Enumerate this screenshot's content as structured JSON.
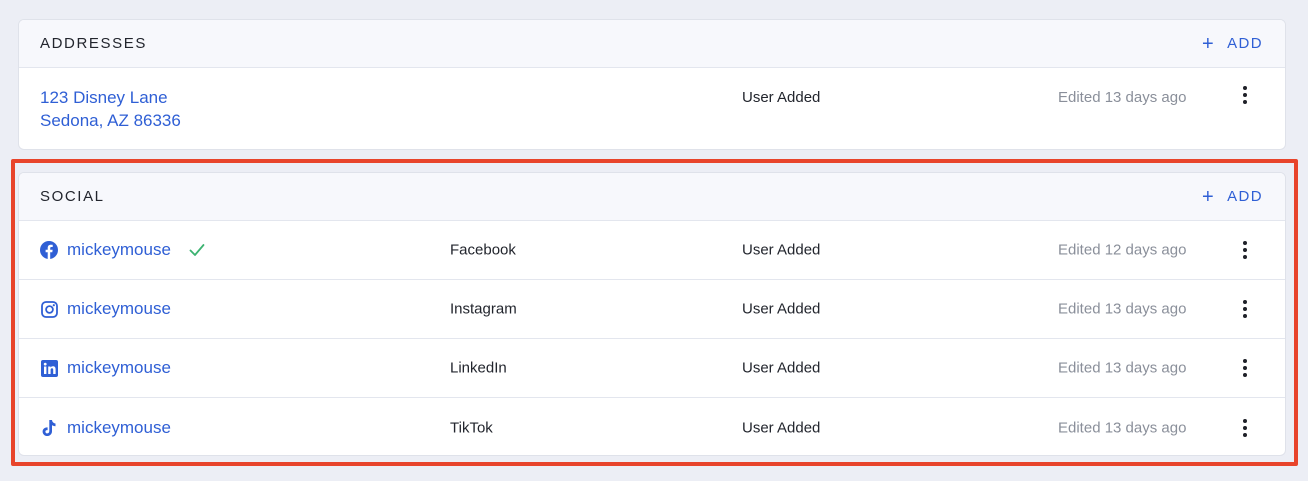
{
  "addresses": {
    "title": "ADDRESSES",
    "add_label": "ADD",
    "items": [
      {
        "line1": "123 Disney Lane",
        "line2": "Sedona, AZ 86336",
        "source": "User Added",
        "edited": "Edited 13 days ago"
      }
    ]
  },
  "social": {
    "title": "SOCIAL",
    "add_label": "ADD",
    "items": [
      {
        "handle": "mickeymouse",
        "platform": "Facebook",
        "icon": "facebook-icon",
        "verified": true,
        "source": "User Added",
        "edited": "Edited 12 days ago"
      },
      {
        "handle": "mickeymouse",
        "platform": "Instagram",
        "icon": "instagram-icon",
        "verified": false,
        "source": "User Added",
        "edited": "Edited 13 days ago"
      },
      {
        "handle": "mickeymouse",
        "platform": "LinkedIn",
        "icon": "linkedin-icon",
        "verified": false,
        "source": "User Added",
        "edited": "Edited 13 days ago"
      },
      {
        "handle": "mickeymouse",
        "platform": "TikTok",
        "icon": "tiktok-icon",
        "verified": false,
        "source": "User Added",
        "edited": "Edited 13 days ago"
      }
    ]
  },
  "colors": {
    "accent": "#2f5fd5",
    "verified": "#3cb371",
    "highlight": "#e8442b"
  }
}
